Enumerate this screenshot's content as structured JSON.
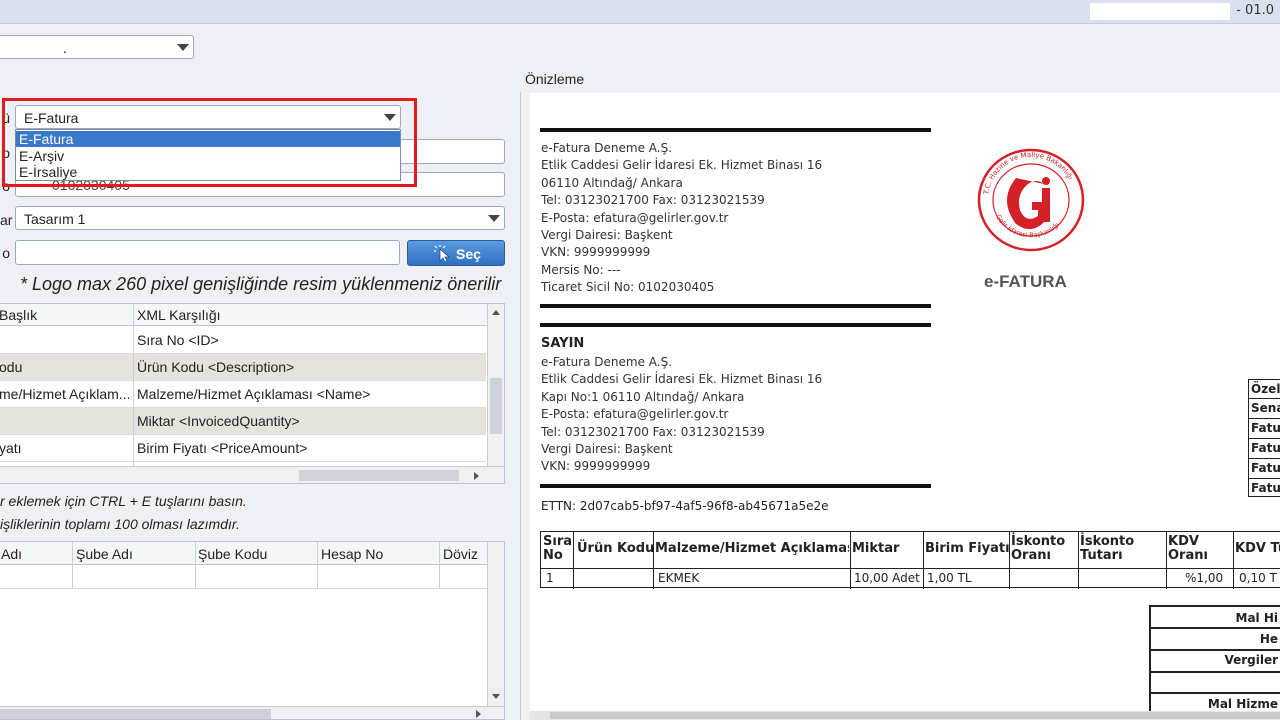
{
  "title_bar": {
    "text": "- 01.0"
  },
  "top_combo": {
    "value": "."
  },
  "form": {
    "type_label": "ü",
    "type_combo": {
      "value": "E-Fatura",
      "options": [
        "E-Fatura",
        "E-Arşiv",
        "E-İrsaliye"
      ]
    },
    "field2_label": "o",
    "field3_label": "o",
    "field3_value": "0102030405",
    "design_label": "ar",
    "design_combo_value": "Tasarım 1",
    "logo_label": "o",
    "select_button": "Seç",
    "logo_note": "* Logo max 260 pixel genişliğinde resim yüklenmeniz önerilir"
  },
  "mapping_grid": {
    "headers": [
      "Başlık",
      "XML Karşılığı"
    ],
    "rows": [
      [
        "",
        "Sıra No <ID>"
      ],
      [
        "odu",
        "Ürün Kodu <Description>"
      ],
      [
        "me/Hizmet Açıklam...",
        "Malzeme/Hizmet Açıklaması <Name>"
      ],
      [
        "",
        "Miktar <InvoicedQuantity>"
      ],
      [
        "yatı",
        "Birim Fiyatı <PriceAmount>"
      ]
    ]
  },
  "hints": {
    "ctrl_e": "r eklemek için CTRL + E tuşlarını basın.",
    "total_100": "işliklerinin toplamı 100 olması lazımdır."
  },
  "bank_grid": {
    "headers": [
      "Adı",
      "Şube Adı",
      "Şube Kodu",
      "Hesap No",
      "Döviz"
    ]
  },
  "preview": {
    "label": "Önizleme",
    "sender_lines": [
      "e-Fatura Deneme A.Ş.",
      "Etlik Caddesi Gelir İdaresi Ek. Hizmet Binası 16",
      "06110 Altındağ/ Ankara",
      "Tel: 03123021700 Fax: 03123021539",
      "E-Posta: efatura@gelirler.gov.tr",
      "Vergi Dairesi: Başkent",
      "VKN: 9999999999",
      "Mersis No: ---",
      "Ticaret Sicil No: 0102030405"
    ],
    "logo_ring_text": "T.C. Hazine ve Maliye Bakanlığı · Gelir İdaresi Başkanlığı",
    "logo_letter": "Gi",
    "doc_type": "e-FATURA",
    "sayin": "SAYIN",
    "recipient_lines": [
      "e-Fatura Deneme A.Ş.",
      "Etlik Caddesi Gelir İdaresi Ek. Hizmet Binası 16",
      "Kapı No:1 06110 Altındağ/ Ankara",
      "E-Posta: efatura@gelirler.gov.tr",
      "Tel: 03123021700 Fax: 03123021539",
      "Vergi Dairesi: Başkent",
      "VKN: 9999999999"
    ],
    "ettn": "ETTN: 2d07cab5-bf97-4af5-96f8-ab45671a5e2e",
    "info_box": [
      "Özel",
      "Sena",
      "Fatu",
      "Fatu",
      "Fatu",
      "Fatu"
    ],
    "items_table": {
      "headers": [
        "Sıra No",
        "Ürün Kodu",
        "Malzeme/Hizmet Açıklaması",
        "Miktar",
        "Birim Fiyatı",
        "İskonto Oranı",
        "İskonto Tutarı",
        "KDV Oranı",
        "KDV Tu"
      ],
      "row": [
        "1",
        "",
        "EKMEK",
        "10,00 Adet",
        "1,00 TL",
        "",
        "",
        "%1,00",
        "0,10 T"
      ]
    },
    "totals": [
      "Mal Hi",
      "He",
      "Vergiler",
      "",
      "Mal Hizme"
    ]
  },
  "colors": {
    "accent": "#3a78c9",
    "highlight": "#e31b1b",
    "logo_red": "#d42027"
  }
}
